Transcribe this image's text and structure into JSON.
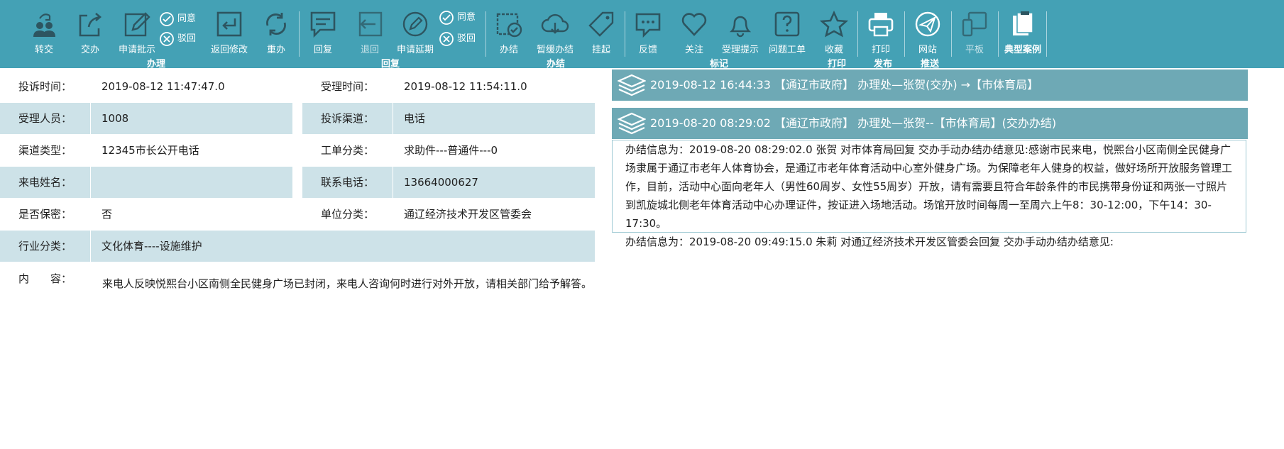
{
  "toolbar": {
    "buttons": [
      {
        "label": "转交",
        "icon": "transfer-users-icon"
      },
      {
        "label": "交办",
        "icon": "assign-share-icon"
      },
      {
        "label": "申请批示",
        "icon": "edit-pen-icon"
      },
      {
        "label": "返回修改",
        "icon": "return-modify-icon"
      },
      {
        "label": "重办",
        "icon": "redo-cycle-icon"
      },
      {
        "label": "回复",
        "icon": "reply-message-icon"
      },
      {
        "label": "退回",
        "icon": "send-back-icon"
      },
      {
        "label": "申请延期",
        "icon": "extend-edit-icon"
      },
      {
        "label": "办结",
        "icon": "complete-calendar-icon"
      },
      {
        "label": "暂缓办结",
        "icon": "postpone-cloud-icon"
      },
      {
        "label": "挂起",
        "icon": "suspend-tag-icon"
      },
      {
        "label": "反馈",
        "icon": "feedback-chat-icon"
      },
      {
        "label": "关注",
        "icon": "heart-icon"
      },
      {
        "label": "受理提示",
        "icon": "bell-icon"
      },
      {
        "label": "问题工单",
        "icon": "question-ticket-icon"
      },
      {
        "label": "收藏",
        "icon": "star-icon"
      },
      {
        "label": "打印",
        "icon": "printer-icon"
      },
      {
        "label": "网站",
        "icon": "paper-plane-icon"
      },
      {
        "label": "平板",
        "icon": "tablet-phone-icon"
      },
      {
        "label": "典型案例",
        "icon": "clipboard-cases-icon"
      }
    ],
    "approve_1": "同意",
    "reject_1": "驳回",
    "approve_2": "同意",
    "reject_2": "驳回",
    "groups": {
      "handle": "办理",
      "reply": "回复",
      "finish": "办结",
      "mark": "标记",
      "print": "打印",
      "publish": "发布",
      "push": "推送"
    }
  },
  "form": {
    "complaint_time_label": "投诉时间：",
    "complaint_time_value": "2019-08-12 11:47:47.0",
    "accept_time_label": "受理时间：",
    "accept_time_value": "2019-08-12 11:54:11.0",
    "receiver_label": "受理人员：",
    "receiver_value": "1008",
    "channel_label": "投诉渠道：",
    "channel_value": "电话",
    "channel_type_label": "渠道类型：",
    "channel_type_value": "12345市长公开电话",
    "order_type_label": "工单分类：",
    "order_type_value": "求助件---普通件---0",
    "caller_label": "来电姓名：",
    "caller_value": "",
    "phone_label": "联系电话：",
    "phone_value": "13664000627",
    "confidential_label": "是否保密：",
    "confidential_value": "否",
    "unit_label": "单位分类：",
    "unit_value": "通辽经济技术开发区管委会",
    "industry_label": "行业分类：",
    "industry_value": "文化体育----设施维护",
    "content_label": "内　　容：",
    "content_value": "来电人反映悦熙台小区南侧全民健身广场已封闭，来电人咨询何时进行对外开放，请相关部门给予解答。"
  },
  "history": [
    {
      "text": "2019-08-12 16:44:33 【通辽市政府】 办理处—张贺(交办) →【市体育局】"
    },
    {
      "text": "2019-08-20 08:29:02 【通辽市政府】 办理处—张贺--【市体育局】(交办办结)"
    }
  ],
  "detail": {
    "para1": "办结信息为：2019-08-20 08:29:02.0  张贺  对市体育局回复  交办手动办结办结意见:感谢市民来电，悦熙台小区南侧全民健身广场隶属于通辽市老年人体育协会，是通辽市老年体育活动中心室外健身广场。为保障老年人健身的权益，做好场所开放服务管理工作，目前，活动中心面向老年人（男性60周岁、女性55周岁）开放，请有需要且符合年龄条件的市民携带身份证和两张一寸照片到凯旋城北侧老年体育活动中心办理证件，按证进入场地活动。场馆开放时间每周一至周六上午8：30-12:00，下午14：30-17:30。",
    "para2": "办结信息为：2019-08-20 09:49:15.0  朱莉  对通辽经济技术开发区管委会回复  交办手动办结办结意见:"
  },
  "colors": {
    "toolbar_bg": "#44a1b5",
    "row_shade": "#cde2e8",
    "history_bar": "#6ea9b5",
    "detail_border": "#9ec9d3"
  }
}
